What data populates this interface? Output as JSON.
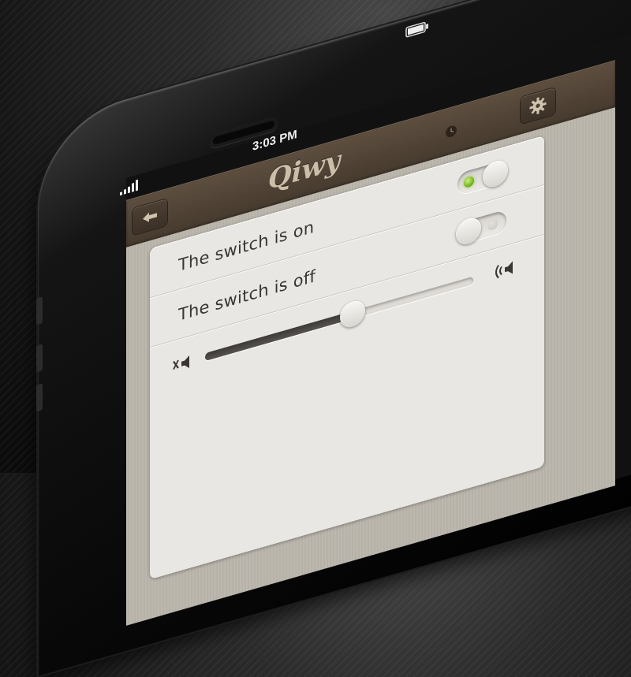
{
  "status_bar": {
    "time": "3:03 PM",
    "signal_icon": "signal-bars-icon",
    "battery_icon": "battery-icon"
  },
  "header": {
    "app_name": "Qiwy",
    "back_icon": "back-arrow-icon",
    "settings_icon": "gear-icon",
    "clock_icon": "clock-icon",
    "color": "#54463a"
  },
  "settings": {
    "rows": [
      {
        "label": "The switch is on",
        "type": "toggle",
        "state": "on"
      },
      {
        "label": "The switch is off",
        "type": "toggle",
        "state": "off"
      }
    ],
    "volume": {
      "level": 0.55,
      "min_icon": "mute-icon",
      "max_icon": "volume-high-icon"
    }
  },
  "colors": {
    "toggle_on": "#7ac02a",
    "card_bg": "#e9e7e3",
    "text": "#3a3633"
  }
}
